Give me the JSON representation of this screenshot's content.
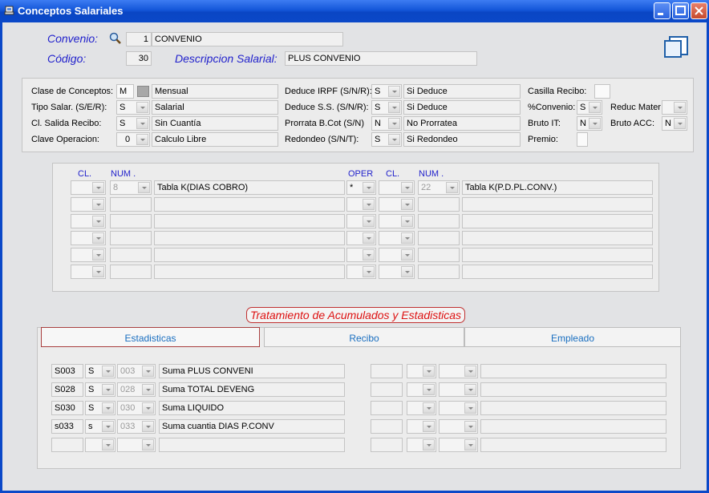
{
  "window": {
    "title": "Conceptos Salariales"
  },
  "header": {
    "convenio_label": "Convenio:",
    "convenio_code": "1",
    "convenio_name": "CONVENIO",
    "codigo_label": "Código:",
    "codigo_value": "30",
    "descripcion_label": "Descripcion Salarial:",
    "descripcion_value": "PLUS CONVENIO"
  },
  "props": {
    "clase_label": "Clase de Conceptos:",
    "clase_code": "M",
    "clase_desc": "Mensual",
    "tipo_label": "Tipo Salar. (S/E/R):",
    "tipo_code": "S",
    "tipo_desc": "Salarial",
    "salida_label": "Cl. Salida Recibo:",
    "salida_code": "S",
    "salida_desc": "Sin Cuantía",
    "clave_label": "Clave Operacion:",
    "clave_code": "0",
    "clave_desc": "Calculo Libre",
    "irpf_label": "Deduce IRPF (S/N/R):",
    "irpf_code": "S",
    "irpf_desc": "Si Deduce",
    "ss_label": "Deduce S.S. (S/N/R):",
    "ss_code": "S",
    "ss_desc": "Si Deduce",
    "prorrata_label": "Prorrata B.Cot (S/N)",
    "prorrata_code": "N",
    "prorrata_desc": "No Prorratea",
    "redondeo_label": "Redondeo (S/N/T):",
    "redondeo_code": "S",
    "redondeo_desc": "Si Redondeo",
    "casilla_label": "Casilla Recibo:",
    "pconvenio_label": "%Convenio:",
    "pconvenio_code": "S",
    "reduc_label": "Reduc Mater",
    "bruto_it_label": "Bruto IT:",
    "bruto_it_code": "N",
    "bruto_acc_label": "Bruto ACC:",
    "bruto_acc_code": "N",
    "premio_label": "Premio:"
  },
  "formula": {
    "headers": {
      "cl1": "CL.",
      "num1": "NUM .",
      "oper": "OPER",
      "cl2": "CL.",
      "num2": "NUM ."
    },
    "rows": [
      {
        "cl1": "",
        "num1": "8",
        "desc1": "Tabla K(DIAS COBRO)",
        "oper": "*",
        "cl2": "",
        "num2": "22",
        "desc2": "Tabla K(P.D.PL.CONV.)"
      },
      {
        "cl1": "",
        "num1": "",
        "desc1": "",
        "oper": "",
        "cl2": "",
        "num2": "",
        "desc2": ""
      },
      {
        "cl1": "",
        "num1": "",
        "desc1": "",
        "oper": "",
        "cl2": "",
        "num2": "",
        "desc2": ""
      },
      {
        "cl1": "",
        "num1": "",
        "desc1": "",
        "oper": "",
        "cl2": "",
        "num2": "",
        "desc2": ""
      },
      {
        "cl1": "",
        "num1": "",
        "desc1": "",
        "oper": "",
        "cl2": "",
        "num2": "",
        "desc2": ""
      },
      {
        "cl1": "",
        "num1": "",
        "desc1": "",
        "oper": "",
        "cl2": "",
        "num2": "",
        "desc2": ""
      }
    ]
  },
  "acumulados": {
    "title": "Tratamiento de Acumulados y Estadisticas",
    "tabs": [
      "Estadisticas",
      "Recibo",
      "Empleado"
    ],
    "rows": [
      {
        "code": "S003",
        "flag": "S",
        "num": "003",
        "desc": "Suma PLUS CONVENI"
      },
      {
        "code": "S028",
        "flag": "S",
        "num": "028",
        "desc": "Suma TOTAL DEVENG"
      },
      {
        "code": "S030",
        "flag": "S",
        "num": "030",
        "desc": "Suma LIQUIDO"
      },
      {
        "code": "s033",
        "flag": "s",
        "num": "033",
        "desc": "Suma cuantia DIAS P.CONV"
      },
      {
        "code": "",
        "flag": "",
        "num": "",
        "desc": ""
      }
    ]
  }
}
